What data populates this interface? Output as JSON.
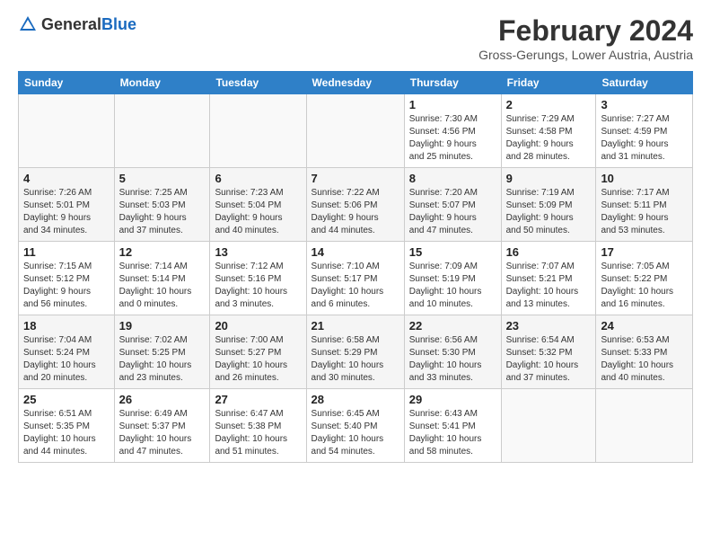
{
  "header": {
    "logo_general": "General",
    "logo_blue": "Blue",
    "title": "February 2024",
    "subtitle": "Gross-Gerungs, Lower Austria, Austria"
  },
  "weekdays": [
    "Sunday",
    "Monday",
    "Tuesday",
    "Wednesday",
    "Thursday",
    "Friday",
    "Saturday"
  ],
  "weeks": [
    [
      {
        "day": "",
        "info": ""
      },
      {
        "day": "",
        "info": ""
      },
      {
        "day": "",
        "info": ""
      },
      {
        "day": "",
        "info": ""
      },
      {
        "day": "1",
        "info": "Sunrise: 7:30 AM\nSunset: 4:56 PM\nDaylight: 9 hours\nand 25 minutes."
      },
      {
        "day": "2",
        "info": "Sunrise: 7:29 AM\nSunset: 4:58 PM\nDaylight: 9 hours\nand 28 minutes."
      },
      {
        "day": "3",
        "info": "Sunrise: 7:27 AM\nSunset: 4:59 PM\nDaylight: 9 hours\nand 31 minutes."
      }
    ],
    [
      {
        "day": "4",
        "info": "Sunrise: 7:26 AM\nSunset: 5:01 PM\nDaylight: 9 hours\nand 34 minutes."
      },
      {
        "day": "5",
        "info": "Sunrise: 7:25 AM\nSunset: 5:03 PM\nDaylight: 9 hours\nand 37 minutes."
      },
      {
        "day": "6",
        "info": "Sunrise: 7:23 AM\nSunset: 5:04 PM\nDaylight: 9 hours\nand 40 minutes."
      },
      {
        "day": "7",
        "info": "Sunrise: 7:22 AM\nSunset: 5:06 PM\nDaylight: 9 hours\nand 44 minutes."
      },
      {
        "day": "8",
        "info": "Sunrise: 7:20 AM\nSunset: 5:07 PM\nDaylight: 9 hours\nand 47 minutes."
      },
      {
        "day": "9",
        "info": "Sunrise: 7:19 AM\nSunset: 5:09 PM\nDaylight: 9 hours\nand 50 minutes."
      },
      {
        "day": "10",
        "info": "Sunrise: 7:17 AM\nSunset: 5:11 PM\nDaylight: 9 hours\nand 53 minutes."
      }
    ],
    [
      {
        "day": "11",
        "info": "Sunrise: 7:15 AM\nSunset: 5:12 PM\nDaylight: 9 hours\nand 56 minutes."
      },
      {
        "day": "12",
        "info": "Sunrise: 7:14 AM\nSunset: 5:14 PM\nDaylight: 10 hours\nand 0 minutes."
      },
      {
        "day": "13",
        "info": "Sunrise: 7:12 AM\nSunset: 5:16 PM\nDaylight: 10 hours\nand 3 minutes."
      },
      {
        "day": "14",
        "info": "Sunrise: 7:10 AM\nSunset: 5:17 PM\nDaylight: 10 hours\nand 6 minutes."
      },
      {
        "day": "15",
        "info": "Sunrise: 7:09 AM\nSunset: 5:19 PM\nDaylight: 10 hours\nand 10 minutes."
      },
      {
        "day": "16",
        "info": "Sunrise: 7:07 AM\nSunset: 5:21 PM\nDaylight: 10 hours\nand 13 minutes."
      },
      {
        "day": "17",
        "info": "Sunrise: 7:05 AM\nSunset: 5:22 PM\nDaylight: 10 hours\nand 16 minutes."
      }
    ],
    [
      {
        "day": "18",
        "info": "Sunrise: 7:04 AM\nSunset: 5:24 PM\nDaylight: 10 hours\nand 20 minutes."
      },
      {
        "day": "19",
        "info": "Sunrise: 7:02 AM\nSunset: 5:25 PM\nDaylight: 10 hours\nand 23 minutes."
      },
      {
        "day": "20",
        "info": "Sunrise: 7:00 AM\nSunset: 5:27 PM\nDaylight: 10 hours\nand 26 minutes."
      },
      {
        "day": "21",
        "info": "Sunrise: 6:58 AM\nSunset: 5:29 PM\nDaylight: 10 hours\nand 30 minutes."
      },
      {
        "day": "22",
        "info": "Sunrise: 6:56 AM\nSunset: 5:30 PM\nDaylight: 10 hours\nand 33 minutes."
      },
      {
        "day": "23",
        "info": "Sunrise: 6:54 AM\nSunset: 5:32 PM\nDaylight: 10 hours\nand 37 minutes."
      },
      {
        "day": "24",
        "info": "Sunrise: 6:53 AM\nSunset: 5:33 PM\nDaylight: 10 hours\nand 40 minutes."
      }
    ],
    [
      {
        "day": "25",
        "info": "Sunrise: 6:51 AM\nSunset: 5:35 PM\nDaylight: 10 hours\nand 44 minutes."
      },
      {
        "day": "26",
        "info": "Sunrise: 6:49 AM\nSunset: 5:37 PM\nDaylight: 10 hours\nand 47 minutes."
      },
      {
        "day": "27",
        "info": "Sunrise: 6:47 AM\nSunset: 5:38 PM\nDaylight: 10 hours\nand 51 minutes."
      },
      {
        "day": "28",
        "info": "Sunrise: 6:45 AM\nSunset: 5:40 PM\nDaylight: 10 hours\nand 54 minutes."
      },
      {
        "day": "29",
        "info": "Sunrise: 6:43 AM\nSunset: 5:41 PM\nDaylight: 10 hours\nand 58 minutes."
      },
      {
        "day": "",
        "info": ""
      },
      {
        "day": "",
        "info": ""
      }
    ]
  ]
}
